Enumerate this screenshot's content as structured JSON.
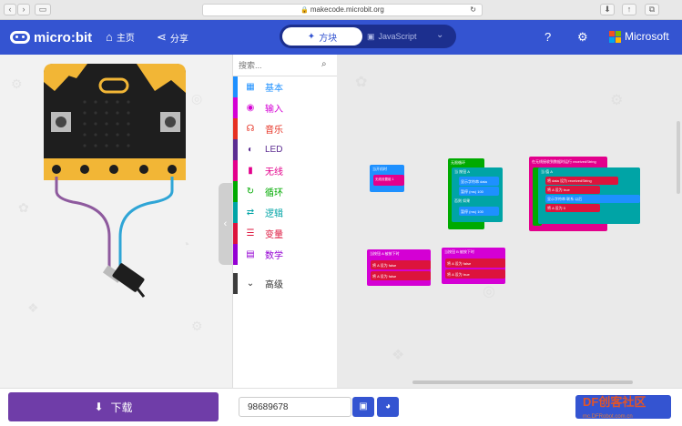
{
  "browser": {
    "url": "makecode.microbit.org"
  },
  "appbar": {
    "brand": "micro:bit",
    "home": "主页",
    "share": "分享",
    "blocks": "方块",
    "javascript": "JavaScript",
    "microsoft": "Microsoft"
  },
  "toolbox": {
    "search_placeholder": "搜索...",
    "categories": [
      {
        "label": "基本",
        "color": "#1e90ff",
        "icon": "grid-icon"
      },
      {
        "label": "输入",
        "color": "#d400d4",
        "icon": "target-icon"
      },
      {
        "label": "音乐",
        "color": "#e63022",
        "icon": "headphones-icon"
      },
      {
        "label": "LED",
        "color": "#5c2d91",
        "icon": "toggle-icon"
      },
      {
        "label": "无线",
        "color": "#e3008c",
        "icon": "signal-icon"
      },
      {
        "label": "循环",
        "color": "#00aa00",
        "icon": "refresh-icon"
      },
      {
        "label": "逻辑",
        "color": "#00a4a6",
        "icon": "shuffle-icon"
      },
      {
        "label": "变量",
        "color": "#dc143c",
        "icon": "list-icon"
      },
      {
        "label": "数学",
        "color": "#9400d3",
        "icon": "calculator-icon"
      },
      {
        "label": "高级",
        "color": "#3c3c3c",
        "icon": "chevron-down-icon"
      }
    ]
  },
  "workspace": {
    "blocks": [
      {
        "head": "当开机时",
        "sub": "无线设置组 1"
      },
      {
        "head": "无限循环",
        "lines": [
          "当 按钮 A",
          "显示字符串 data",
          "暂停 (ms) 100",
          "否则 如果",
          "暂停 (ms) 100"
        ]
      },
      {
        "head": "在无线接收到数据时运行 receivedString",
        "lines": [
          "当 值 A",
          "将 data 设为 receivedString",
          "将 A 设为 true",
          "显示字符串 联系 以后",
          "将 A 设为 0"
        ]
      },
      {
        "head": "当按钮 A 被按下时",
        "lines": [
          "将 A 设为 false",
          "将 A 设为 false"
        ]
      },
      {
        "head": "当按钮 B 被按下时",
        "lines": [
          "将 A 设为 false",
          "将 A 设为 true"
        ]
      }
    ]
  },
  "bottom": {
    "download": "下载",
    "project_name": "98689678"
  },
  "watermark": {
    "text": "DF创客社区",
    "url": "mc.DFRobot.com.cn"
  }
}
